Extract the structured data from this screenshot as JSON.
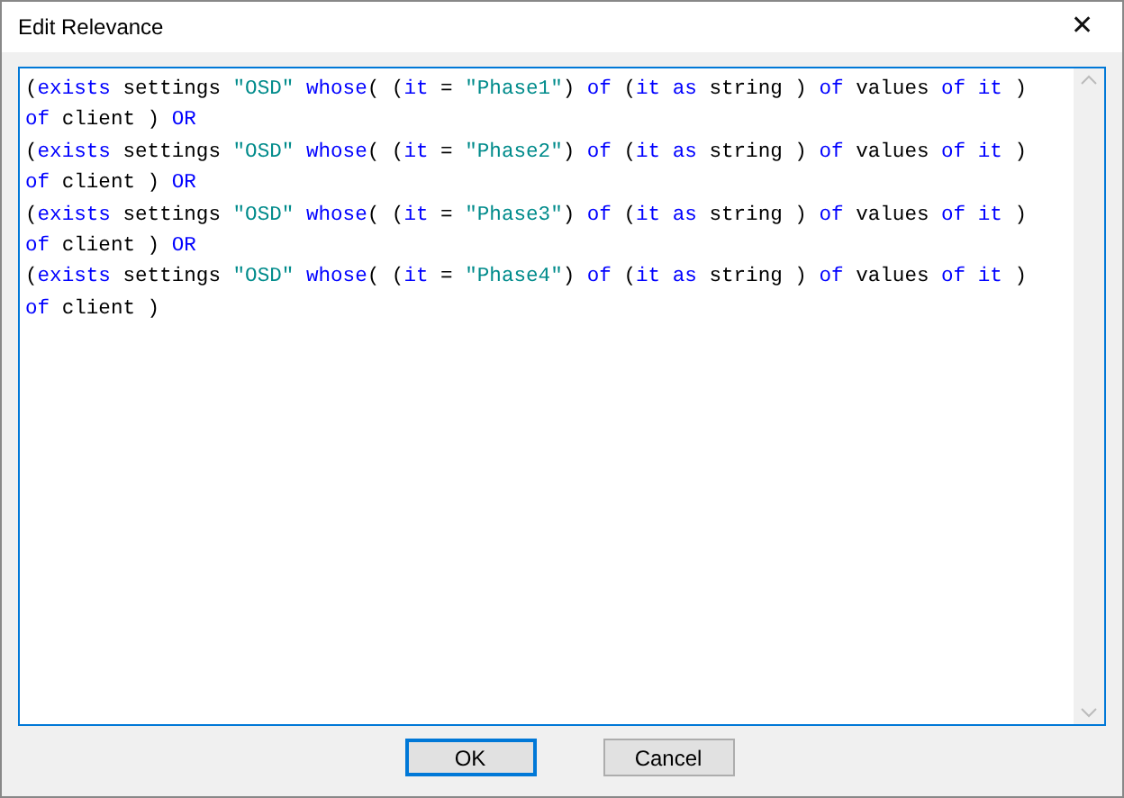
{
  "window": {
    "title": "Edit Relevance",
    "close_glyph": "✕"
  },
  "editor": {
    "lines": [
      [
        {
          "kind": "plain",
          "text": "("
        },
        {
          "kind": "keyword",
          "text": "exists"
        },
        {
          "kind": "plain",
          "text": " settings "
        },
        {
          "kind": "string",
          "text": "\"OSD\" "
        },
        {
          "kind": "keyword",
          "text": "whose"
        },
        {
          "kind": "plain",
          "text": "( ("
        },
        {
          "kind": "keyword",
          "text": "it"
        },
        {
          "kind": "plain",
          "text": " = "
        },
        {
          "kind": "string",
          "text": "\"Phase1\""
        },
        {
          "kind": "plain",
          "text": ") "
        },
        {
          "kind": "keyword",
          "text": "of"
        },
        {
          "kind": "plain",
          "text": " ("
        },
        {
          "kind": "keyword",
          "text": "it as"
        },
        {
          "kind": "plain",
          "text": " string ) "
        },
        {
          "kind": "keyword",
          "text": "of"
        },
        {
          "kind": "plain",
          "text": " values "
        },
        {
          "kind": "keyword",
          "text": "of it"
        },
        {
          "kind": "plain",
          "text": " )"
        }
      ],
      [
        {
          "kind": "keyword",
          "text": "of"
        },
        {
          "kind": "plain",
          "text": " client ) "
        },
        {
          "kind": "keyword",
          "text": "OR"
        }
      ],
      [
        {
          "kind": "plain",
          "text": "("
        },
        {
          "kind": "keyword",
          "text": "exists"
        },
        {
          "kind": "plain",
          "text": " settings "
        },
        {
          "kind": "string",
          "text": "\"OSD\" "
        },
        {
          "kind": "keyword",
          "text": "whose"
        },
        {
          "kind": "plain",
          "text": "( ("
        },
        {
          "kind": "keyword",
          "text": "it"
        },
        {
          "kind": "plain",
          "text": " = "
        },
        {
          "kind": "string",
          "text": "\"Phase2\""
        },
        {
          "kind": "plain",
          "text": ") "
        },
        {
          "kind": "keyword",
          "text": "of"
        },
        {
          "kind": "plain",
          "text": " ("
        },
        {
          "kind": "keyword",
          "text": "it as"
        },
        {
          "kind": "plain",
          "text": " string ) "
        },
        {
          "kind": "keyword",
          "text": "of"
        },
        {
          "kind": "plain",
          "text": " values "
        },
        {
          "kind": "keyword",
          "text": "of it"
        },
        {
          "kind": "plain",
          "text": " )"
        }
      ],
      [
        {
          "kind": "keyword",
          "text": "of"
        },
        {
          "kind": "plain",
          "text": " client ) "
        },
        {
          "kind": "keyword",
          "text": "OR"
        }
      ],
      [
        {
          "kind": "plain",
          "text": "("
        },
        {
          "kind": "keyword",
          "text": "exists"
        },
        {
          "kind": "plain",
          "text": " settings "
        },
        {
          "kind": "string",
          "text": "\"OSD\" "
        },
        {
          "kind": "keyword",
          "text": "whose"
        },
        {
          "kind": "plain",
          "text": "( ("
        },
        {
          "kind": "keyword",
          "text": "it"
        },
        {
          "kind": "plain",
          "text": " = "
        },
        {
          "kind": "string",
          "text": "\"Phase3\""
        },
        {
          "kind": "plain",
          "text": ") "
        },
        {
          "kind": "keyword",
          "text": "of"
        },
        {
          "kind": "plain",
          "text": " ("
        },
        {
          "kind": "keyword",
          "text": "it as"
        },
        {
          "kind": "plain",
          "text": " string ) "
        },
        {
          "kind": "keyword",
          "text": "of"
        },
        {
          "kind": "plain",
          "text": " values "
        },
        {
          "kind": "keyword",
          "text": "of it"
        },
        {
          "kind": "plain",
          "text": " )"
        }
      ],
      [
        {
          "kind": "keyword",
          "text": "of"
        },
        {
          "kind": "plain",
          "text": " client ) "
        },
        {
          "kind": "keyword",
          "text": "OR"
        }
      ],
      [
        {
          "kind": "plain",
          "text": "("
        },
        {
          "kind": "keyword",
          "text": "exists"
        },
        {
          "kind": "plain",
          "text": " settings "
        },
        {
          "kind": "string",
          "text": "\"OSD\" "
        },
        {
          "kind": "keyword",
          "text": "whose"
        },
        {
          "kind": "plain",
          "text": "( ("
        },
        {
          "kind": "keyword",
          "text": "it"
        },
        {
          "kind": "plain",
          "text": " = "
        },
        {
          "kind": "string",
          "text": "\"Phase4\""
        },
        {
          "kind": "plain",
          "text": ") "
        },
        {
          "kind": "keyword",
          "text": "of"
        },
        {
          "kind": "plain",
          "text": " ("
        },
        {
          "kind": "keyword",
          "text": "it as"
        },
        {
          "kind": "plain",
          "text": " string ) "
        },
        {
          "kind": "keyword",
          "text": "of"
        },
        {
          "kind": "plain",
          "text": " values "
        },
        {
          "kind": "keyword",
          "text": "of it"
        },
        {
          "kind": "plain",
          "text": " )"
        }
      ],
      [
        {
          "kind": "keyword",
          "text": "of"
        },
        {
          "kind": "plain",
          "text": " client )"
        }
      ]
    ]
  },
  "buttons": [
    {
      "label": "OK",
      "selected": true
    },
    {
      "label": "Cancel",
      "selected": false
    }
  ]
}
